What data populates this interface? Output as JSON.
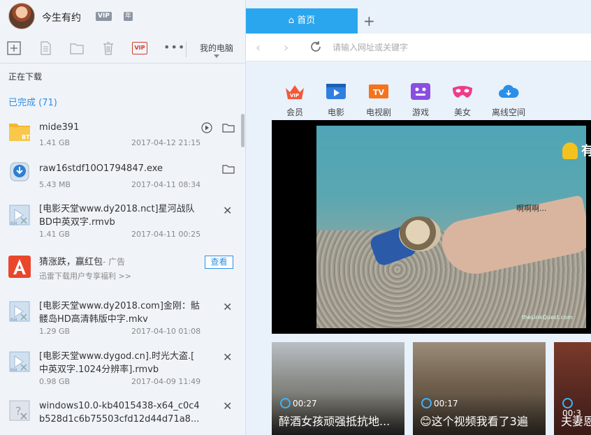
{
  "user": {
    "name": "今生有约",
    "vip_label": "VIP",
    "year_label": "年"
  },
  "toolbar": {
    "vip_label": "VIP",
    "more_label": "•••",
    "location_label": "我的电脑"
  },
  "sections": {
    "downloading": "正在下载",
    "completed": "已完成 (71)"
  },
  "items": [
    {
      "name": "mide391",
      "size": "1.41 GB",
      "date": "2017-04-12 21:15",
      "icon_label": "BT"
    },
    {
      "name": "raw16stdf10O1794847.exe",
      "size": "5.43 MB",
      "date": "2017-04-11 08:34"
    },
    {
      "name_line1": "[电影天堂www.dy2018.nct]星河战队",
      "name_line2": "BD中英双字.rmvb",
      "size": "1.41 GB",
      "date": "2017-04-11 00:25",
      "icon_label": "RM"
    },
    {
      "ad_title": "猜涨跌，赢红包",
      "ad_tag": "- 广告",
      "ad_sub": "迅雷下载用户专享福利 >>",
      "button": "查看"
    },
    {
      "name_line1": "[电影天堂www.dy2018.com]金刚：骷",
      "name_line2": "髅岛HD高清韩版中字.mkv",
      "size": "1.29 GB",
      "date": "2017-04-10 01:08",
      "icon_label": "RM"
    },
    {
      "name_line1": "[电影天堂www.dygod.cn].时光大盗.[",
      "name_line2": "中英双字.1024分辨率].rmvb",
      "size": "0.98 GB",
      "date": "2017-04-09 11:49",
      "icon_label": "RM"
    },
    {
      "name_line1": "windows10.0-kb4015438-x64_c0c4",
      "name_line2": "b528d1c6b75503cfd12d44d71a8..."
    }
  ],
  "browser": {
    "home_tab": "首页",
    "new_tab": "+",
    "address_placeholder": "请输入网址或关键字",
    "categories": [
      "会员",
      "电影",
      "电视剧",
      "游戏",
      "美女",
      "离线空间"
    ],
    "video": {
      "caption": "啊啊啊...",
      "logo": "theLinkQuest.com",
      "side_text": "有"
    },
    "thumbs": [
      {
        "duration": "00:27",
        "title": "醉酒女孩顽强抵抗地..."
      },
      {
        "duration": "00:17",
        "title": "😊这个视频我看了3遍"
      },
      {
        "duration": "00:3",
        "title": "夫妻恩"
      }
    ]
  },
  "colors": {
    "accent": "#2aa6ee",
    "link_blue": "#2e8fe5",
    "vip_red": "#d83a2c"
  }
}
